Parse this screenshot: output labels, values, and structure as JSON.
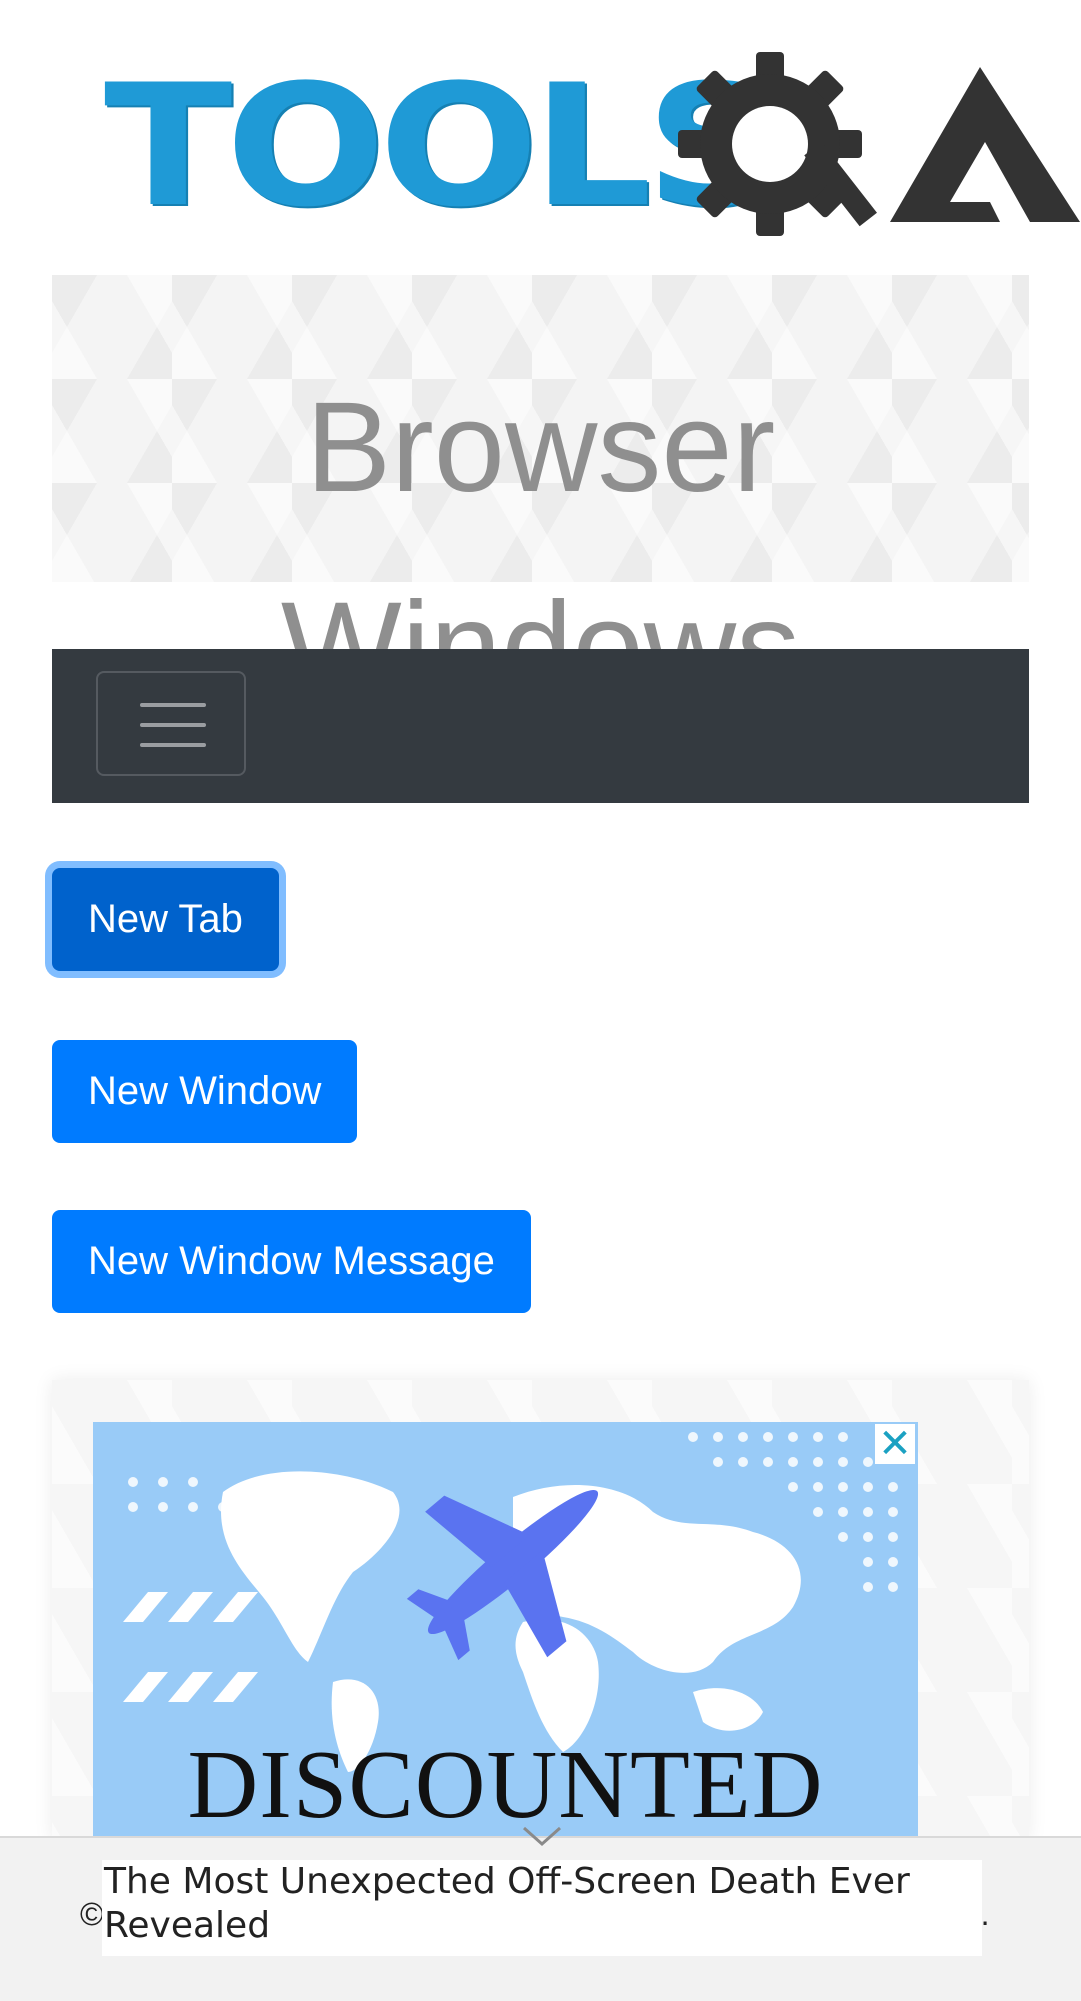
{
  "header": {
    "logo_text": "TOOLS",
    "logo_suffix": "QA"
  },
  "banner": {
    "title": "Browser Windows"
  },
  "navbar": {
    "toggler_icon": "hamburger-menu-icon"
  },
  "actions": {
    "new_tab": "New Tab",
    "new_window": "New Window",
    "new_window_message": "New Window Message"
  },
  "ad": {
    "headline": "DISCOUNTED",
    "close_icon": "close-icon",
    "colors": {
      "background": "#99cbf7",
      "plane": "#5a73f0"
    }
  },
  "footer": {
    "left_glyph": "©",
    "right_glyph": ").",
    "ad_text": "The Most Unexpected Off-Screen Death Ever Revealed",
    "chevron_icon": "chevron-down-icon"
  },
  "colors": {
    "primary": "#007bff",
    "primary_focused": "#0062cc",
    "navbar": "#343a40",
    "logo_blue": "#1f9ad6",
    "logo_dark": "#333333"
  }
}
